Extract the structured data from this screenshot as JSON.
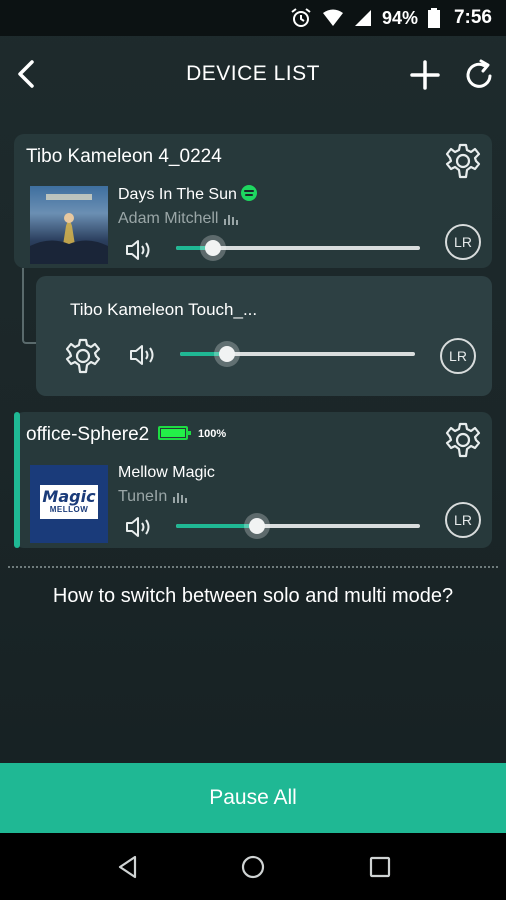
{
  "status_bar": {
    "battery_text": "94%",
    "time": "7:56",
    "icons": [
      "alarm-icon",
      "wifi-icon",
      "signal-icon",
      "battery-icon"
    ]
  },
  "header": {
    "title": "DEVICE LIST",
    "icons": [
      "back-arrow-icon",
      "plus-icon",
      "refresh-icon"
    ]
  },
  "devices": [
    {
      "name": "Tibo Kameleon 4_0224",
      "track_title": "Days In The Sun",
      "artist": "Adam Mitchell",
      "source_icon": "spotify-icon",
      "volume": 0.15,
      "channel": "LR",
      "grouped": {
        "name": "Tibo Kameleon Touch_...",
        "volume": 0.2,
        "channel": "LR"
      }
    },
    {
      "name": "office-Sphere2",
      "battery_percent": "100%",
      "track_title": "Mellow Magic",
      "artist": "TuneIn",
      "album_art_text": {
        "top": "Magic",
        "bottom": "MELLOW"
      },
      "volume": 0.33,
      "channel": "LR"
    }
  ],
  "help_link": "How to switch between solo and multi mode?",
  "pause_all_label": "Pause All",
  "colors": {
    "accent": "#1fb894",
    "card": "#27393b",
    "battery": "#23f048"
  },
  "nav_icons": [
    "back-triangle-icon",
    "home-circle-icon",
    "recents-square-icon"
  ]
}
